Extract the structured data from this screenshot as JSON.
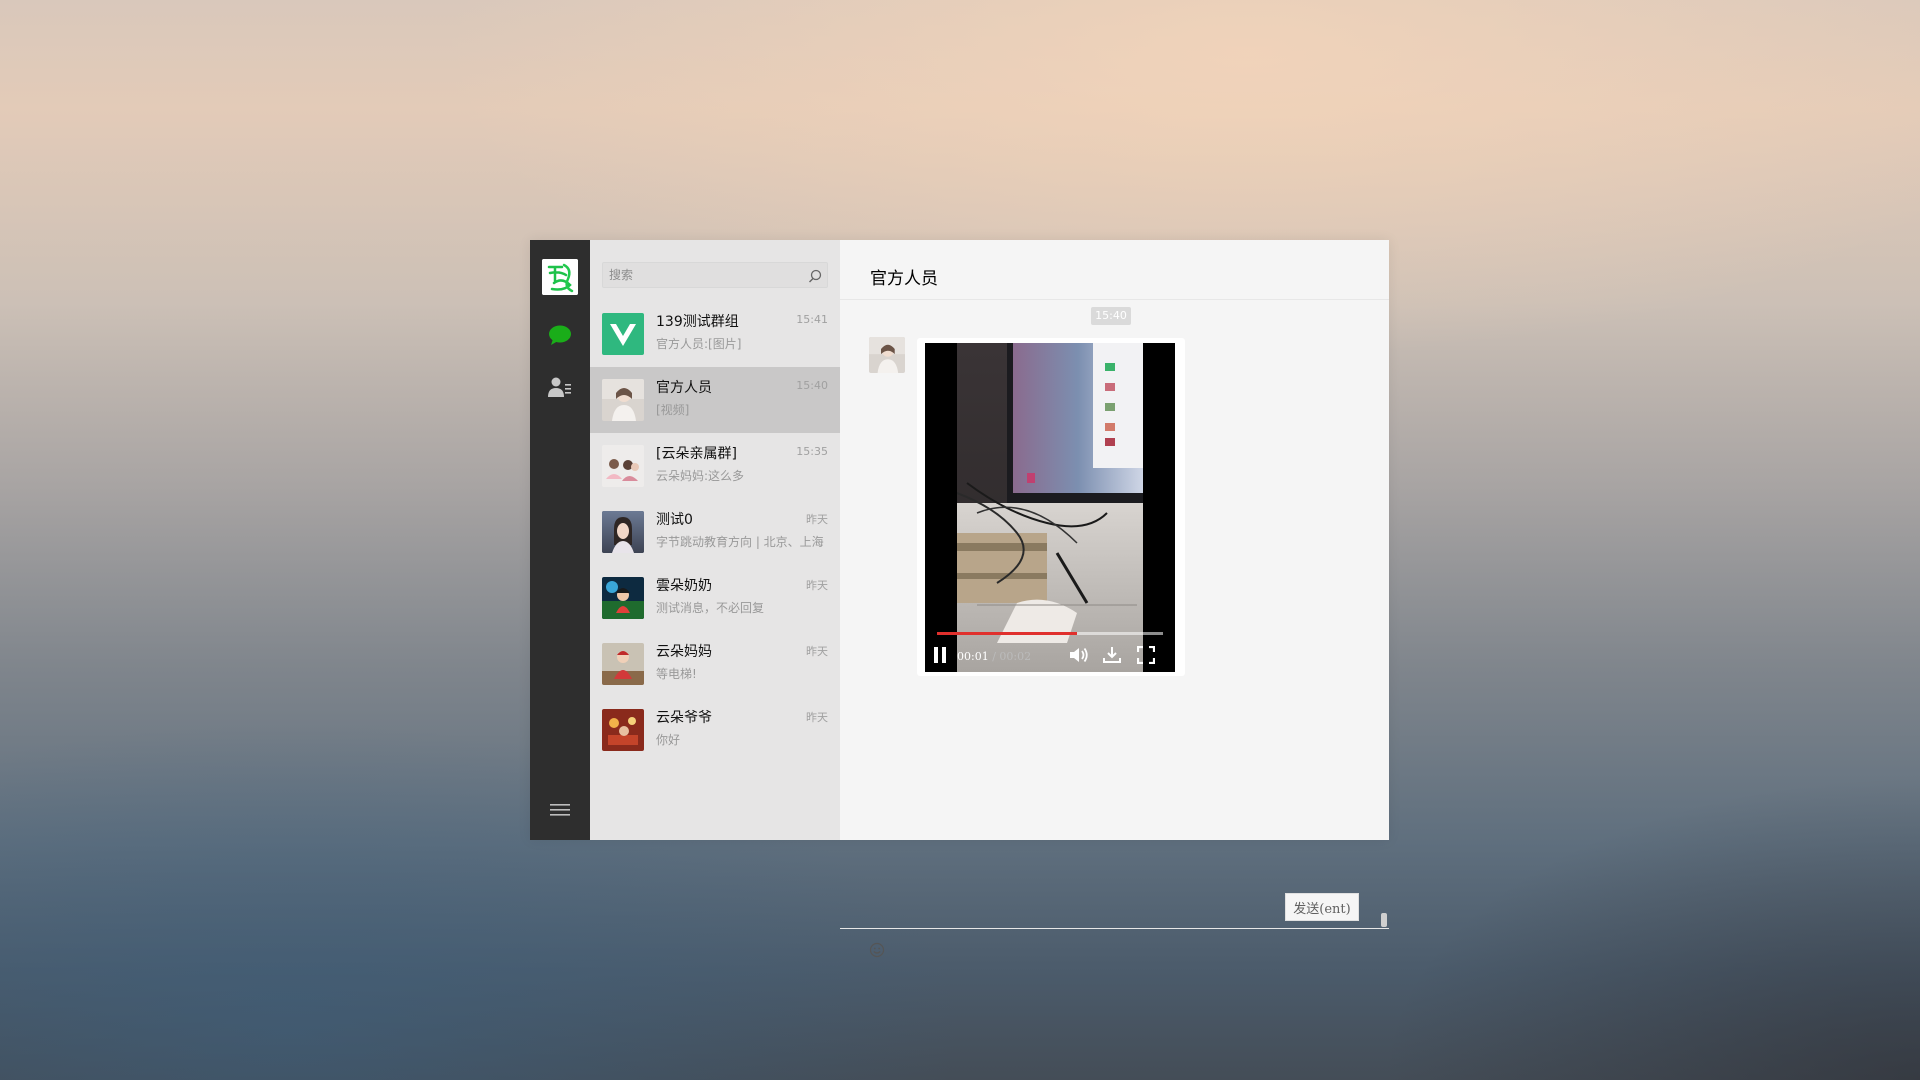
{
  "nav": {
    "items": [
      {
        "icon": "chat-bubble-icon",
        "active": true
      },
      {
        "icon": "contacts-icon",
        "active": false
      }
    ],
    "menu_icon": "hamburger-menu-icon",
    "accent_color": "#1aad19"
  },
  "search": {
    "placeholder": "搜索"
  },
  "conversations": [
    {
      "name": "139测试群组",
      "time": "15:41",
      "preview": "官方人员:[图片]",
      "avatar": "vue-logo"
    },
    {
      "name": "官方人员",
      "time": "15:40",
      "preview": "[视频]",
      "avatar": "person-photo",
      "active": true
    },
    {
      "name": "[云朵亲属群]",
      "time": "15:35",
      "preview": "云朵妈妈:这么多",
      "avatar": "group-photo"
    },
    {
      "name": "测试0",
      "time": "昨天",
      "preview": "字节跳动教育方向 | 北京、上海",
      "avatar": "portrait-photo"
    },
    {
      "name": "雲朵奶奶",
      "time": "昨天",
      "preview": "测试消息，不必回复",
      "avatar": "anime-photo"
    },
    {
      "name": "云朵妈妈",
      "time": "昨天",
      "preview": "等电梯!",
      "avatar": "child-photo"
    },
    {
      "name": "云朵爷爷",
      "time": "昨天",
      "preview": "你好",
      "avatar": "warm-photo"
    }
  ],
  "chat": {
    "title": "官方人员",
    "time_badge": "15:40",
    "video": {
      "current_time": "00:01",
      "separator": " / ",
      "duration": "00:02",
      "progress": 0.62
    }
  },
  "editor": {
    "send_label": "发送(ent)"
  }
}
